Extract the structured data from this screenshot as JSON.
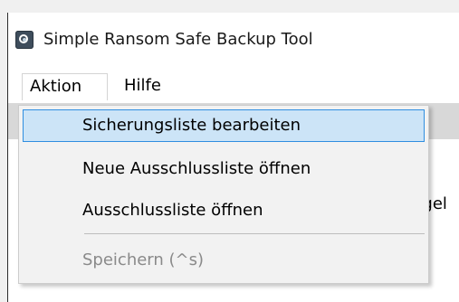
{
  "window": {
    "title": "Simple Ransom Safe Backup Tool",
    "icon": "app-icon",
    "accent": "#0078d7"
  },
  "menubar": {
    "items": [
      {
        "label": "Aktion",
        "open": true
      },
      {
        "label": "Hilfe",
        "open": false
      }
    ]
  },
  "dropdown": {
    "items": [
      {
        "label": "Sicherungsliste bearbeiten",
        "state": "hovered"
      },
      {
        "label": "Neue Ausschlussliste öffnen",
        "state": "normal"
      },
      {
        "label": "Ausschlussliste öffnen",
        "state": "normal"
      },
      {
        "label": "Speichern (^s)",
        "state": "disabled"
      }
    ],
    "hover_color": "#cce4f7",
    "hover_border": "#2f8ee0"
  },
  "background": {
    "partial_text": "ngel"
  }
}
